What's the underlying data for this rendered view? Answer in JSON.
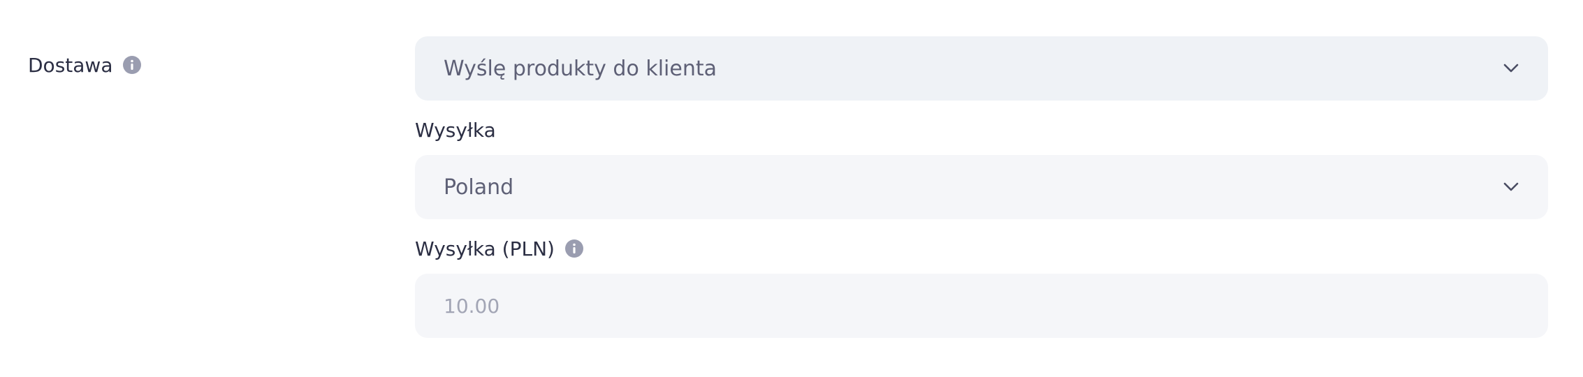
{
  "delivery": {
    "label": "Dostawa",
    "selected": "Wyślę produkty do klienta"
  },
  "shipping": {
    "label": "Wysyłka",
    "selected": "Poland"
  },
  "shipping_cost": {
    "label": "Wysyłka (PLN)",
    "placeholder": "10.00"
  },
  "icons": {
    "info": "info-icon",
    "chevron": "chevron-down-icon"
  },
  "colors": {
    "info_icon": "#9a9db0",
    "select_bg_primary": "#eff2f6",
    "select_bg_secondary": "#f5f6f9"
  }
}
